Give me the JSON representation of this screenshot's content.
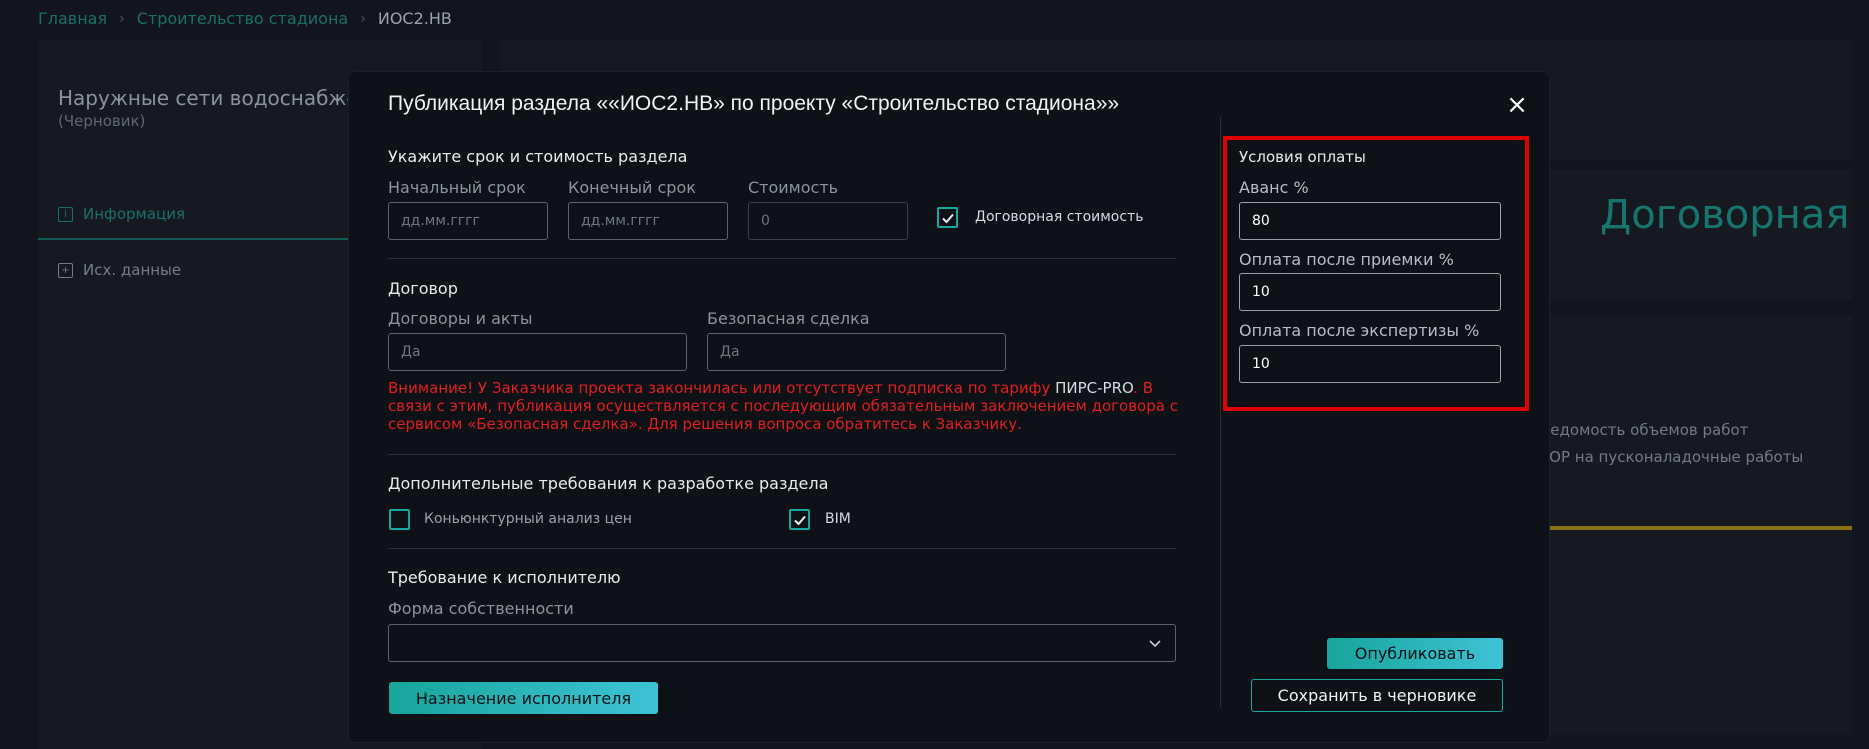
{
  "breadcrumb": {
    "home": "Главная",
    "project": "Строительство стадиона",
    "current": "ИОС2.НВ",
    "separator": "›"
  },
  "background": {
    "section_title": "Наружные сети водоснабжения",
    "status": "(Черновик)",
    "tab_info": "Информация",
    "tab_source": "Исх. данные",
    "contract_label": "Договорная",
    "doc_line1": "Ведомость объемов работ",
    "doc_line2": "ТОР на пусконаладочные работы"
  },
  "modal": {
    "title": "Публикация раздела ««ИОС2.НВ» по проекту «Строительство стадиона»»",
    "close_icon": "×",
    "term_section": {
      "heading": "Укажите срок и стоимость раздела",
      "start_label": "Начальный срок",
      "start_placeholder": "дд.мм.гггг",
      "end_label": "Конечный срок",
      "end_placeholder": "дд.мм.гггг",
      "cost_label": "Стоимость",
      "cost_placeholder": "0",
      "negotiable_label": "Договорная стоимость",
      "negotiable_checked": true
    },
    "contract_section": {
      "heading": "Договор",
      "acts_label": "Договоры и акты",
      "acts_placeholder": "Да",
      "safe_deal_label": "Безопасная сделка",
      "safe_deal_placeholder": "Да"
    },
    "warning": {
      "part1": "Внимание! У Заказчика проекта закончилась или отсутствует подписка по тарифу ",
      "brand": "ПИРС-PRO",
      "part2": ". В связи с этим, публикация осуществляется с последующим обязательным заключением договора с сервисом «Безопасная сделка». Для решения вопроса обратитесь к Заказчику."
    },
    "extra_section": {
      "heading": "Дополнительные требования к разработке раздела",
      "market_label": "Коньюнктурный анализ цен",
      "market_checked": false,
      "bim_label": "BIM",
      "bim_checked": true
    },
    "executor_section": {
      "heading": "Требование к исполнителю",
      "ownership_label": "Форма собственности",
      "ownership_value": ""
    },
    "assign_button": "Назначение исполнителя",
    "payment": {
      "heading": "Условия оплаты",
      "advance_label": "Аванс %",
      "advance_value": "80",
      "acceptance_label": "Оплата после приемки %",
      "acceptance_value": "10",
      "expertise_label": "Оплата после экспертизы %",
      "expertise_value": "10"
    },
    "publish_button": "Опубликовать",
    "draft_button": "Сохранить в черновике"
  },
  "colors": {
    "accent": "#17a59b",
    "warning": "#e01f1f",
    "highlight_box": "#e00000"
  }
}
